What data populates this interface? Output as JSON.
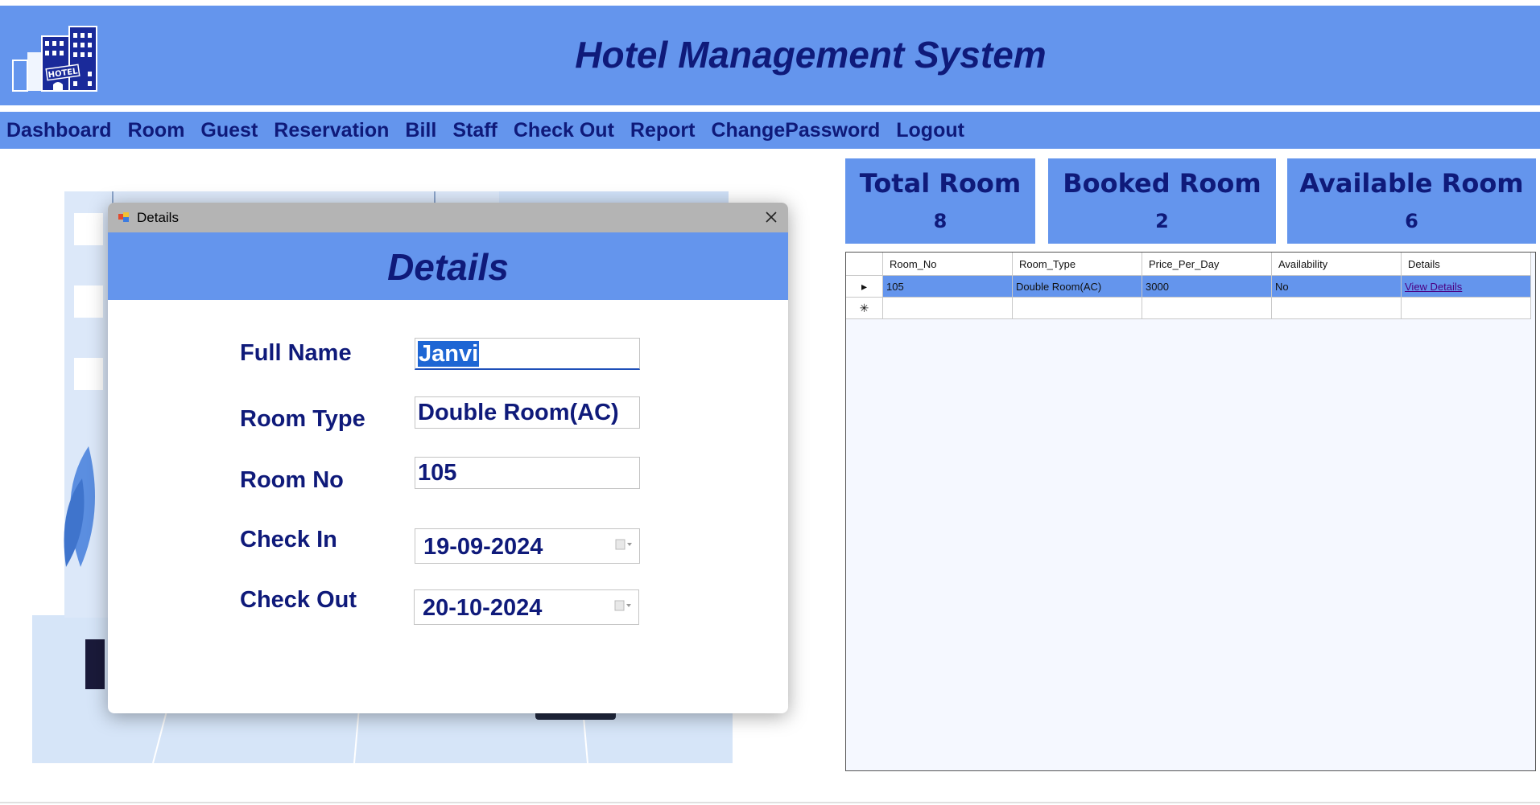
{
  "header": {
    "title": "Hotel Management System",
    "logo_text": "HOTEL",
    "logo_icon": "hotel-building-icon"
  },
  "menu": [
    {
      "label": "Dashboard"
    },
    {
      "label": "Room"
    },
    {
      "label": "Guest"
    },
    {
      "label": "Reservation"
    },
    {
      "label": "Bill"
    },
    {
      "label": "Staff"
    },
    {
      "label": "Check Out"
    },
    {
      "label": "Report"
    },
    {
      "label": "ChangePassword"
    },
    {
      "label": "Logout"
    }
  ],
  "stats": {
    "total": {
      "label": "Total Room",
      "value": "8"
    },
    "booked": {
      "label": "Booked Room",
      "value": "2"
    },
    "available": {
      "label": "Available Room",
      "value": "6"
    }
  },
  "grid": {
    "columns": [
      "Room_No",
      "Room_Type",
      "Price_Per_Day",
      "Availability",
      "Details"
    ],
    "rows": [
      {
        "room_no": "105",
        "room_type": "Double Room(AC)",
        "price": "3000",
        "availability": "No",
        "details": "View Details"
      }
    ],
    "row_indicator": "▸",
    "new_row_indicator": "✳"
  },
  "dialog": {
    "title": "Details",
    "heading": "Details",
    "fields": {
      "full_name": {
        "label": "Full Name",
        "value": "Janvi"
      },
      "room_type": {
        "label": "Room Type",
        "value": "Double Room(AC)"
      },
      "room_no": {
        "label": "Room No",
        "value": "105"
      },
      "check_in": {
        "label": "Check In",
        "value": "19-09-2024"
      },
      "check_out": {
        "label": "Check Out",
        "value": "20-10-2024"
      }
    }
  },
  "colors": {
    "accent": "#6495ed",
    "text_dark": "#0f1a7a",
    "selection": "#1e66d4"
  }
}
